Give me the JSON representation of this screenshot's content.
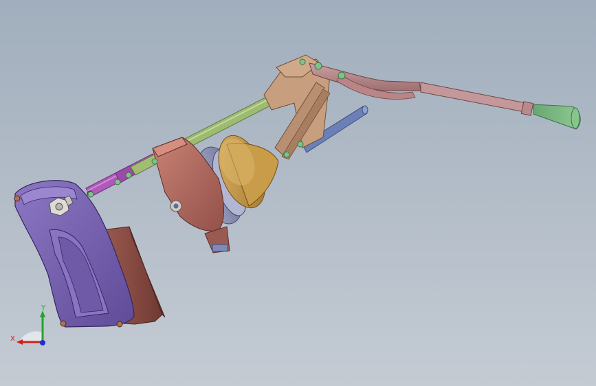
{
  "viewport": {
    "background_top": "#a1aebd",
    "background_bottom": "#c4cbd3"
  },
  "model": {
    "parts": [
      {
        "name": "mounting-bracket",
        "color": "#7b64b2"
      },
      {
        "name": "foot-plate",
        "color": "#8a4b43"
      },
      {
        "name": "shift-rod",
        "color": "#98b36c"
      },
      {
        "name": "rod-coupler",
        "color": "#a957b3"
      },
      {
        "name": "gear-housing",
        "color": "#b66a5f"
      },
      {
        "name": "disc",
        "color": "#8f94b5"
      },
      {
        "name": "rubber-boot",
        "color": "#c39a4e"
      },
      {
        "name": "linkage-arm",
        "color": "#c39b7d"
      },
      {
        "name": "guide-shaft",
        "color": "#6a7db3"
      },
      {
        "name": "shift-lever",
        "color": "#b88a8c"
      },
      {
        "name": "knob",
        "color": "#79b57f"
      },
      {
        "name": "pin",
        "color": "#7fc38a"
      }
    ]
  },
  "triad": {
    "x_label": "X",
    "y_label": "Y",
    "x_color": "#cc1f1f",
    "y_color": "#22a52a",
    "z_color": "#1f2fd0"
  }
}
